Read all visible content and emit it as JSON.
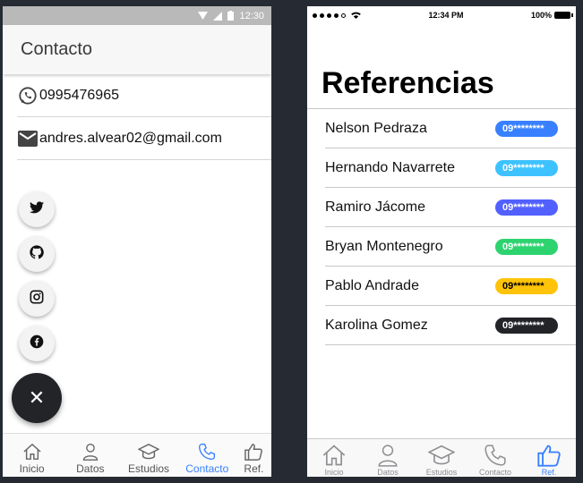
{
  "android": {
    "status_time": "12:30",
    "title": "Contacto",
    "contacts": [
      {
        "icon": "whatsapp-icon",
        "value": "0995476965"
      },
      {
        "icon": "email-icon",
        "value": "andres.alvear02@gmail.com"
      }
    ],
    "fab_social": [
      "twitter-icon",
      "github-icon",
      "instagram-icon",
      "facebook-icon"
    ],
    "fab_main_icon": "close-icon",
    "tabs": [
      {
        "label": "Inicio",
        "icon": "home-icon"
      },
      {
        "label": "Datos",
        "icon": "person-icon"
      },
      {
        "label": "Estudios",
        "icon": "school-icon"
      },
      {
        "label": "Contacto",
        "icon": "call-icon",
        "active": true
      },
      {
        "label": "Ref.",
        "icon": "thumbs-up-icon"
      }
    ],
    "accent": "#3880ff"
  },
  "ios": {
    "status_time": "12:34 PM",
    "battery": "100%",
    "title": "Referencias",
    "references": [
      {
        "name": "Nelson Pedraza",
        "phone": "09********",
        "color": "#3880ff"
      },
      {
        "name": "Hernando Navarrete",
        "phone": "09********",
        "color": "#3dc2ff"
      },
      {
        "name": "Ramiro Jácome",
        "phone": "09********",
        "color": "#5260ff"
      },
      {
        "name": "Bryan Montenegro",
        "phone": "09********",
        "color": "#2dd36f"
      },
      {
        "name": "Pablo Andrade",
        "phone": "09********",
        "color": "#ffc409",
        "text_color": "#000000"
      },
      {
        "name": "Karolina Gomez",
        "phone": "09********",
        "color": "#222428"
      }
    ],
    "tabs": [
      {
        "label": "Inicio",
        "icon": "home-icon"
      },
      {
        "label": "Datos",
        "icon": "person-icon"
      },
      {
        "label": "Estudios",
        "icon": "school-icon"
      },
      {
        "label": "Contacto",
        "icon": "call-icon"
      },
      {
        "label": "Ref.",
        "icon": "thumbs-up-icon",
        "active": true
      }
    ]
  }
}
